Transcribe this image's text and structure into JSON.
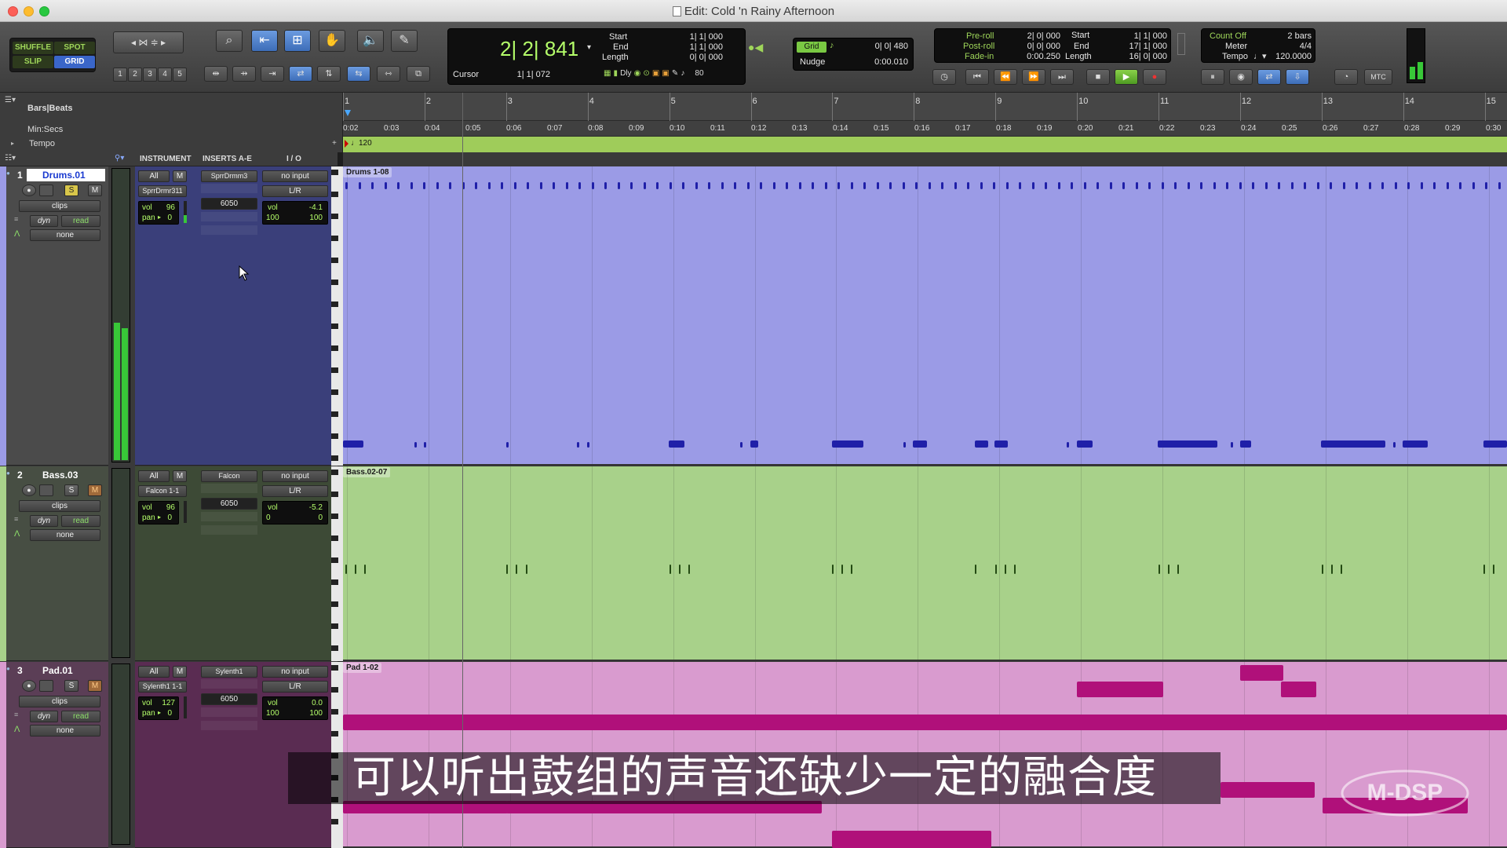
{
  "window": {
    "title": "Edit: Cold 'n Rainy Afternoon"
  },
  "modes": {
    "shuffle": "SHUFFLE",
    "spot": "SPOT",
    "slip": "SLIP",
    "grid": "GRID"
  },
  "zoom_presets": [
    "1",
    "2",
    "3",
    "4",
    "5"
  ],
  "counter": {
    "main": "2| 2| 841",
    "cursor_label": "Cursor",
    "cursor_value": "1| 1| 072",
    "start_label": "Start",
    "start_value": "1| 1| 000",
    "end_label": "End",
    "end_value": "1| 1| 000",
    "length_label": "Length",
    "length_value": "0| 0| 000",
    "dly_label": "Dly",
    "value_80": "80"
  },
  "grid_nudge": {
    "grid_label": "Grid",
    "grid_value": "0| 0| 480",
    "nudge_label": "Nudge",
    "nudge_value": "0:00.010"
  },
  "transport": {
    "preroll_label": "Pre-roll",
    "preroll_value": "2| 0| 000",
    "postroll_label": "Post-roll",
    "postroll_value": "0| 0| 000",
    "fadein_label": "Fade-in",
    "fadein_value": "0:00.250",
    "start_label": "Start",
    "start_value": "1| 1| 000",
    "end_label": "End",
    "end_value": "17| 1| 000",
    "length_label": "Length",
    "length_value": "16| 0| 000"
  },
  "meter_tempo": {
    "countoff_label": "Count Off",
    "countoff_value": "2 bars",
    "meter_label": "Meter",
    "meter_value": "4/4",
    "tempo_label": "Tempo",
    "tempo_value": "120.0000"
  },
  "mtc": "MTC",
  "rulers": {
    "bars_beats": "Bars|Beats",
    "min_secs": "Min:Secs",
    "tempo": "Tempo",
    "tempo_marker": "120",
    "bars": [
      "1",
      "2",
      "3",
      "4",
      "5",
      "6",
      "7",
      "8",
      "9",
      "10",
      "11",
      "12",
      "13",
      "14",
      "15"
    ],
    "secs": [
      "0:02",
      "0:03",
      "0:04",
      "0:05",
      "0:06",
      "0:07",
      "0:08",
      "0:09",
      "0:10",
      "0:11",
      "0:12",
      "0:13",
      "0:14",
      "0:15",
      "0:16",
      "0:17",
      "0:18",
      "0:19",
      "0:20",
      "0:21",
      "0:22",
      "0:23",
      "0:24",
      "0:25",
      "0:26",
      "0:27",
      "0:28",
      "0:29",
      "0:30"
    ]
  },
  "columns": {
    "instrument": "INSTRUMENT",
    "inserts": "INSERTS A-E",
    "io": "I / O"
  },
  "tracks": [
    {
      "num": "1",
      "name": "Drums.01",
      "clip": "Drums 1-08",
      "color": "#9b9be6",
      "strip": "#3a3f7a",
      "note_color": "#1f1fa8",
      "all": "All",
      "m": "M",
      "insert": "SprrDrmm3",
      "instrument": "SprrDrmr311",
      "io_in": "no input",
      "io_out": "L/R",
      "vol_label": "vol",
      "vol": "96",
      "pan_label": "pan",
      "pan": "0",
      "insert_num": "6050",
      "out_vol": "-4.1",
      "pan_l": "100",
      "pan_r": "100",
      "view": "clips",
      "dyn": "dyn",
      "auto": "read",
      "none": "none",
      "s": "S",
      "mute": "M"
    },
    {
      "num": "2",
      "name": "Bass.03",
      "clip": "Bass.02-07",
      "color": "#a8d18a",
      "strip": "#3d4a36",
      "note_color": "#234a12",
      "all": "All",
      "m": "M",
      "insert": "Falcon",
      "instrument": "Falcon 1-1",
      "io_in": "no input",
      "io_out": "L/R",
      "vol_label": "vol",
      "vol": "96",
      "pan_label": "pan",
      "pan": "0",
      "insert_num": "6050",
      "out_vol": "-5.2",
      "pan_l": "0",
      "pan_r": "0",
      "view": "clips",
      "dyn": "dyn",
      "auto": "read",
      "none": "none",
      "s": "S",
      "mute": "M"
    },
    {
      "num": "3",
      "name": "Pad.01",
      "clip": "Pad 1-02",
      "color": "#d99bcf",
      "strip": "#5a2c52",
      "note_color": "#b0107a",
      "all": "All",
      "m": "M",
      "insert": "Sylenth1",
      "instrument": "Sylenth1 1-1",
      "io_in": "no input",
      "io_out": "L/R",
      "vol_label": "vol",
      "vol": "127",
      "pan_label": "pan",
      "pan": "0",
      "insert_num": "6050",
      "out_vol": "0.0",
      "pan_l": "100",
      "pan_r": "100",
      "view": "clips",
      "dyn": "dyn",
      "auto": "read",
      "none": "none",
      "s": "S",
      "mute": "M"
    }
  ],
  "subtitle": "可以听出鼓组的声音还缺少一定的融合度",
  "watermark": "M-DSP"
}
